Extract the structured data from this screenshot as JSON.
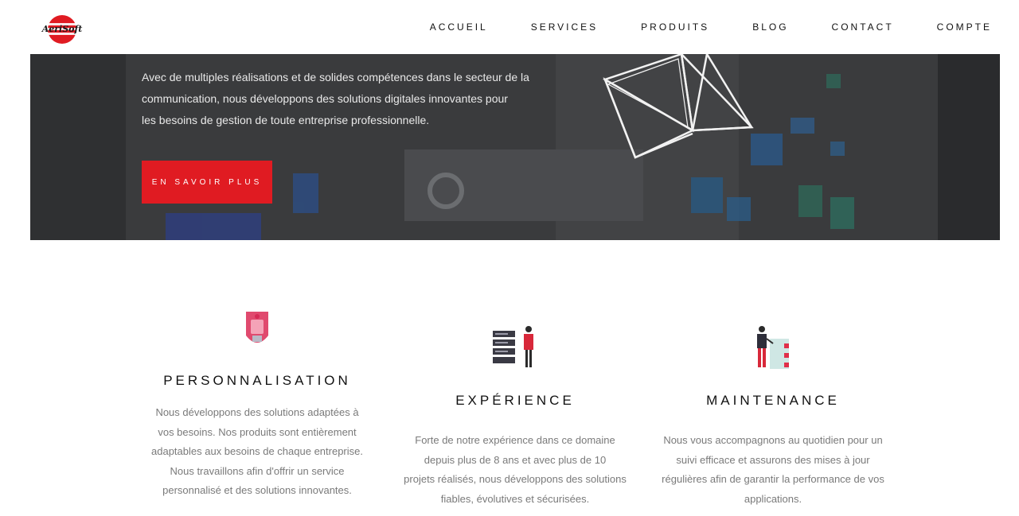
{
  "header": {
    "logo_text": "AeriSoft",
    "nav": [
      "ACCUEIL",
      "SERVICES",
      "PRODUITS",
      "BLOG",
      "CONTACT",
      "COMPTE"
    ]
  },
  "hero": {
    "lines": [
      "Avec de multiples réalisations et de solides compétences dans le secteur de la",
      "communication, nous développons des solutions digitales innovantes pour",
      "les besoins de gestion de toute entreprise professionnelle."
    ],
    "button_label": "EN SAVOIR PLUS"
  },
  "features": [
    {
      "icon": "shield-icon",
      "title": "PERSONNALISATION",
      "lines": [
        "Nous développons des solutions adaptées à",
        "vos besoins. Nos produits sont entièrement",
        "adaptables aux besoins de chaque entreprise.",
        "Nous travaillons afin d'offrir un service",
        "personnalisé et des solutions innovantes."
      ]
    },
    {
      "icon": "server-person-icon",
      "title": "EXPÉRIENCE",
      "lines": [
        "Forte de notre expérience dans ce domaine",
        "depuis plus de 8 ans et avec plus de 10",
        "projets réalisés, nous développons des solutions",
        "fiables, évolutives et sécurisées."
      ]
    },
    {
      "icon": "maintenance-person-icon",
      "title": "MAINTENANCE",
      "lines": [
        "Nous vous accompagnons au quotidien pour un",
        "suivi efficace et assurons des mises à jour",
        "régulières afin de garantir la performance de vos",
        "applications."
      ]
    }
  ],
  "colors": {
    "accent": "#e01b22",
    "hero_bg": "#3a3b3d",
    "text": "#111111",
    "muted": "#7a7a7a"
  }
}
